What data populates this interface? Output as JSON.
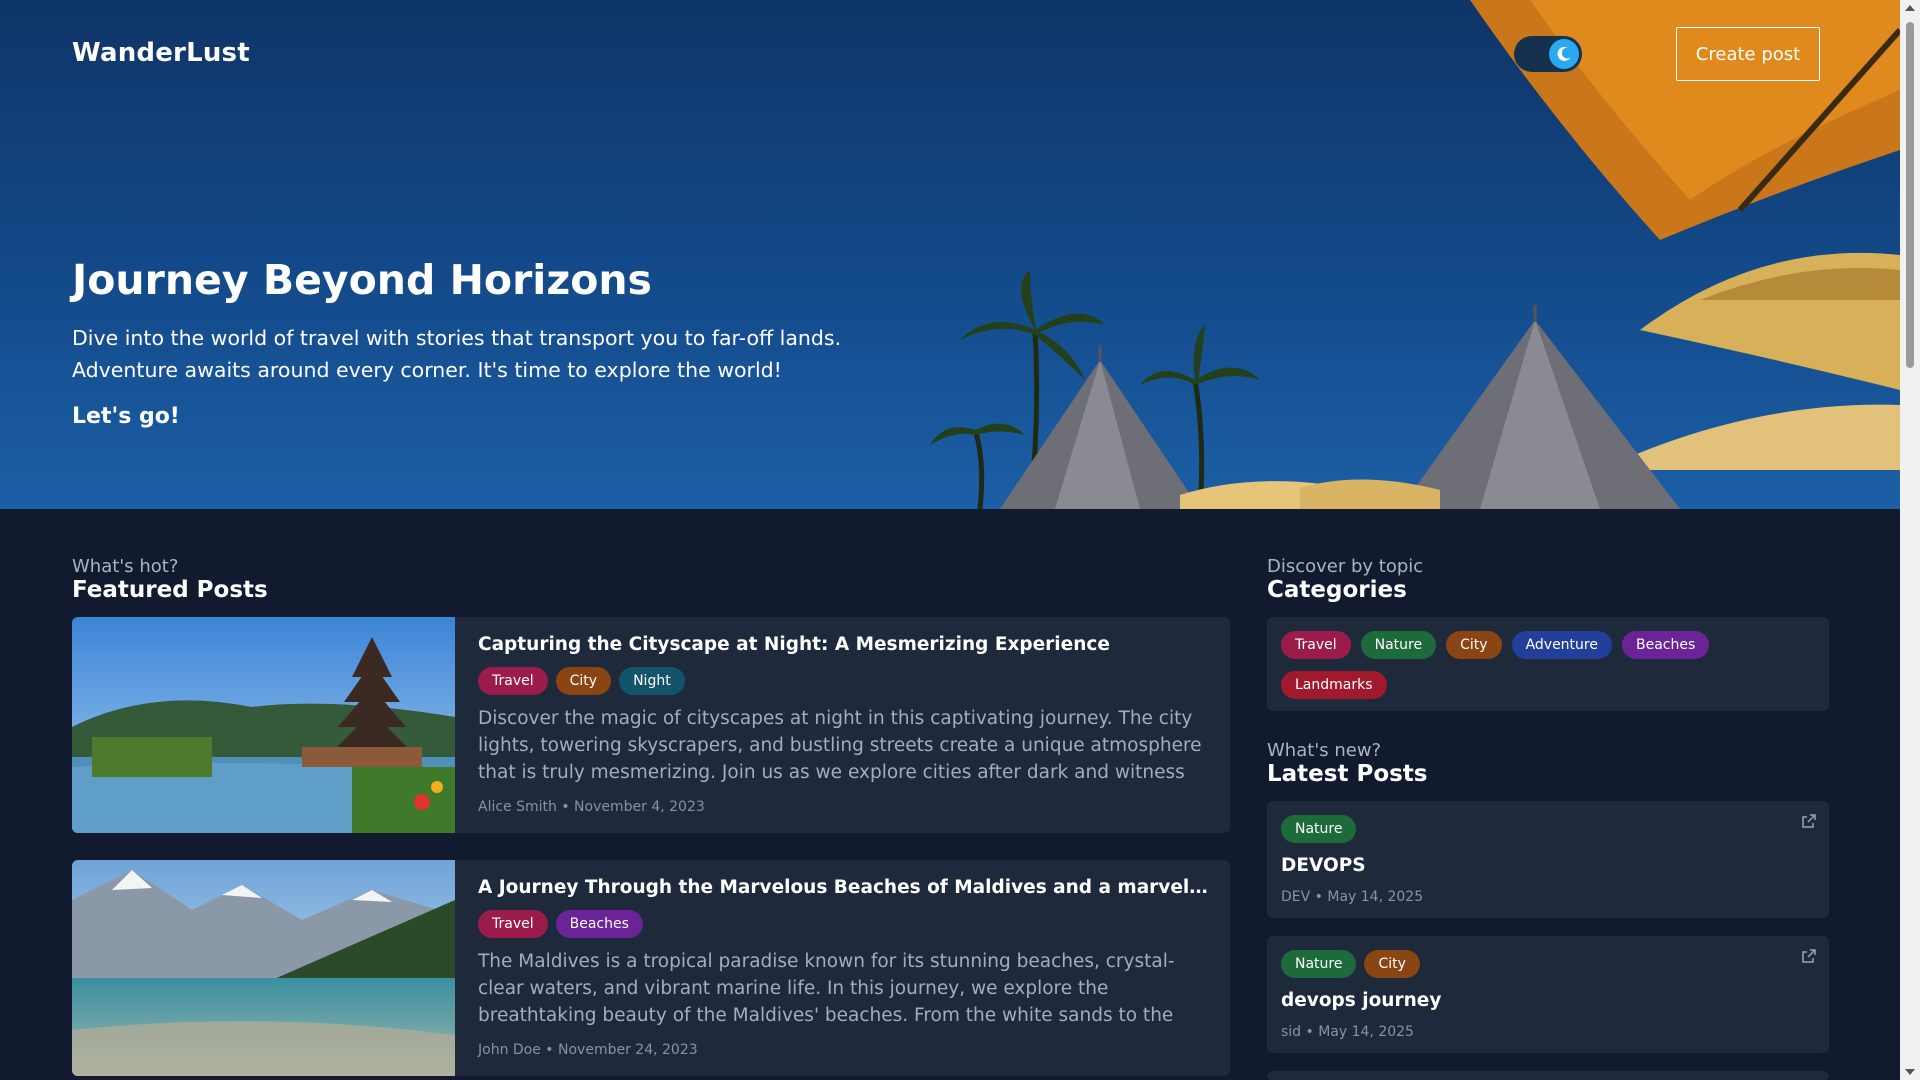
{
  "header": {
    "brand": "WanderLust",
    "theme_toggle_state": "dark",
    "create_post_label": "Create post"
  },
  "hero": {
    "title": "Journey Beyond Horizons",
    "description": "Dive into the world of travel with stories that transport you to far-off lands. Adventure awaits around every corner. It's time to explore the world!",
    "cta": "Let's go!"
  },
  "featured": {
    "eyebrow": "What's hot?",
    "title": "Featured Posts",
    "posts": [
      {
        "title": "Capturing the Cityscape at Night: A Mesmerizing Experience",
        "tags": [
          "Travel",
          "City",
          "Night"
        ],
        "excerpt": "Discover the magic of cityscapes at night in this captivating journey. The city lights, towering skyscrapers, and bustling streets create a unique atmosphere that is truly mesmerizing. Join us as we explore cities after dark and witness their…",
        "meta": "Alice Smith • November 4, 2023"
      },
      {
        "title": "A Journey Through the Marvelous Beaches of Maldives and a marvelous…",
        "tags": [
          "Travel",
          "Beaches"
        ],
        "excerpt": "The Maldives is a tropical paradise known for its stunning beaches, crystal-clear waters, and vibrant marine life. In this journey, we explore the breathtaking beauty of the Maldives' beaches. From the white sands to the vibrant coral reefs, there's…",
        "meta": "John Doe • November 24, 2023"
      }
    ]
  },
  "categories": {
    "eyebrow": "Discover by topic",
    "title": "Categories",
    "items": [
      "Travel",
      "Nature",
      "City",
      "Adventure",
      "Beaches",
      "Landmarks"
    ]
  },
  "latest": {
    "eyebrow": "What's new?",
    "title": "Latest Posts",
    "posts": [
      {
        "tags": [
          "Nature"
        ],
        "title": "DEVOPS",
        "meta": "DEV • May 14, 2025"
      },
      {
        "tags": [
          "Nature",
          "City"
        ],
        "title": "devops journey",
        "meta": "sid • May 14, 2025"
      }
    ]
  },
  "icons": {
    "theme": "moon-icon",
    "external": "external-link-icon"
  },
  "colors": {
    "page_bg": "#111a2e",
    "card_bg": "#1e293b",
    "tag_travel": "#9b1b4a",
    "tag_nature": "#1d6b3a",
    "tag_city": "#8a4512",
    "tag_night": "#14546a",
    "tag_adventure": "#233f9c",
    "tag_beaches": "#6b2398",
    "tag_landmarks": "#a0192c",
    "toggle_knob": "#2aa9f0"
  }
}
